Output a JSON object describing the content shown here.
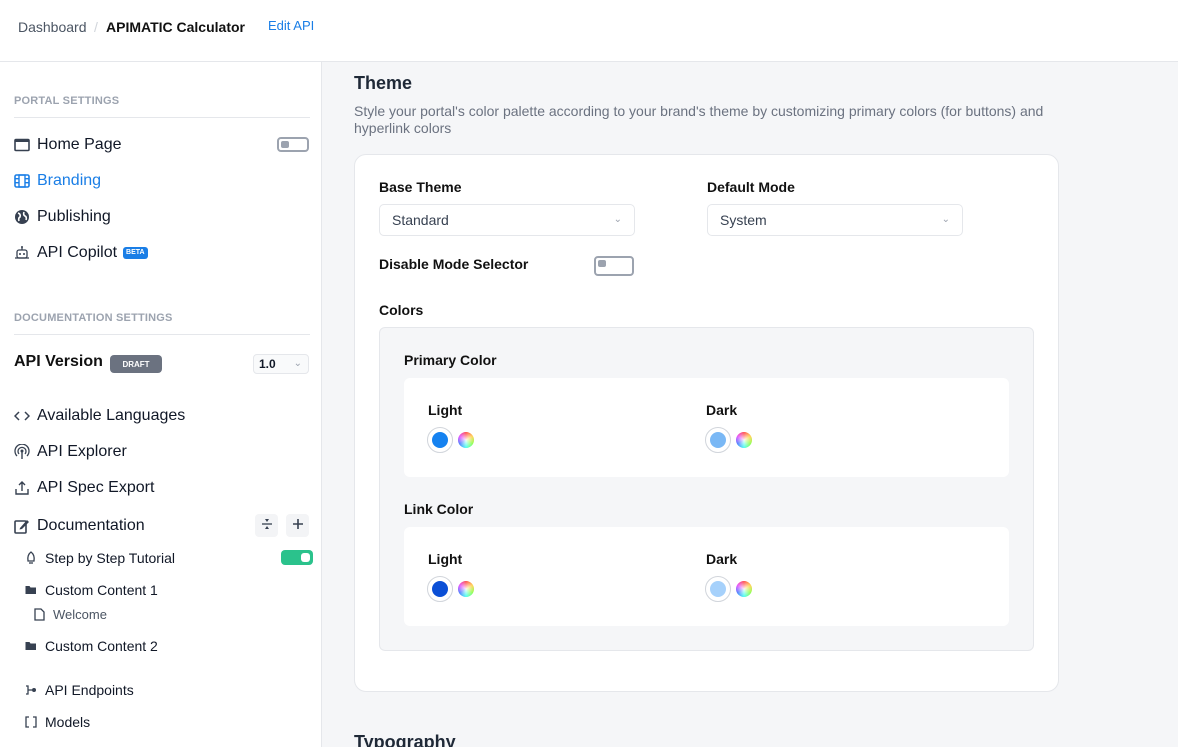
{
  "header": {
    "breadcrumb": [
      "Dashboard",
      "APIMATIC Calculator"
    ],
    "separator": "/",
    "edit_link": "Edit API"
  },
  "sidebar": {
    "portal_settings": {
      "title": "PORTAL SETTINGS",
      "items": [
        {
          "label": "Home Page",
          "icon": "window-icon",
          "toggle": false
        },
        {
          "label": "Branding",
          "icon": "film-icon",
          "active": true
        },
        {
          "label": "Publishing",
          "icon": "globe-icon"
        },
        {
          "label": "API Copilot",
          "icon": "robot-icon",
          "badge": "BETA"
        }
      ]
    },
    "documentation_settings": {
      "title": "DOCUMENTATION SETTINGS",
      "api_version_label": "API Version",
      "version_status": "DRAFT",
      "version_value": "1.0",
      "items": [
        {
          "label": "Available Languages",
          "icon": "code-icon"
        },
        {
          "label": "API Explorer",
          "icon": "broadcast-icon"
        },
        {
          "label": "API Spec Export",
          "icon": "upload-icon"
        },
        {
          "label": "Documentation",
          "icon": "edit-icon"
        }
      ],
      "doc_tree": [
        {
          "label": "Step by Step Tutorial",
          "icon": "rocket-icon",
          "toggle": true
        },
        {
          "label": "Custom Content 1",
          "icon": "folder-icon"
        },
        {
          "label": "Welcome",
          "icon": "file-icon"
        },
        {
          "label": "Custom Content 2",
          "icon": "folder-icon"
        },
        {
          "label": "API Endpoints",
          "icon": "endpoint-icon"
        },
        {
          "label": "Models",
          "icon": "brackets-icon"
        }
      ],
      "collapse_icon": "collapse-icon",
      "add_icon": "plus-icon"
    }
  },
  "main": {
    "theme": {
      "title": "Theme",
      "description": "Style your portal's color palette according to your brand's theme by customizing primary colors (for buttons) and hyperlink colors",
      "base_theme_label": "Base Theme",
      "base_theme_value": "Standard",
      "default_mode_label": "Default Mode",
      "default_mode_value": "System",
      "disable_mode_selector_label": "Disable Mode Selector",
      "disable_mode_selector": false,
      "colors_label": "Colors",
      "primary_color": {
        "label": "Primary Color",
        "light_label": "Light",
        "dark_label": "Dark",
        "light": "#1582f0",
        "dark": "#7ab8f5"
      },
      "link_color": {
        "label": "Link Color",
        "light_label": "Light",
        "dark_label": "Dark",
        "light": "#0b4fd6",
        "dark": "#a6d1fb"
      }
    },
    "typography_title": "Typography"
  }
}
